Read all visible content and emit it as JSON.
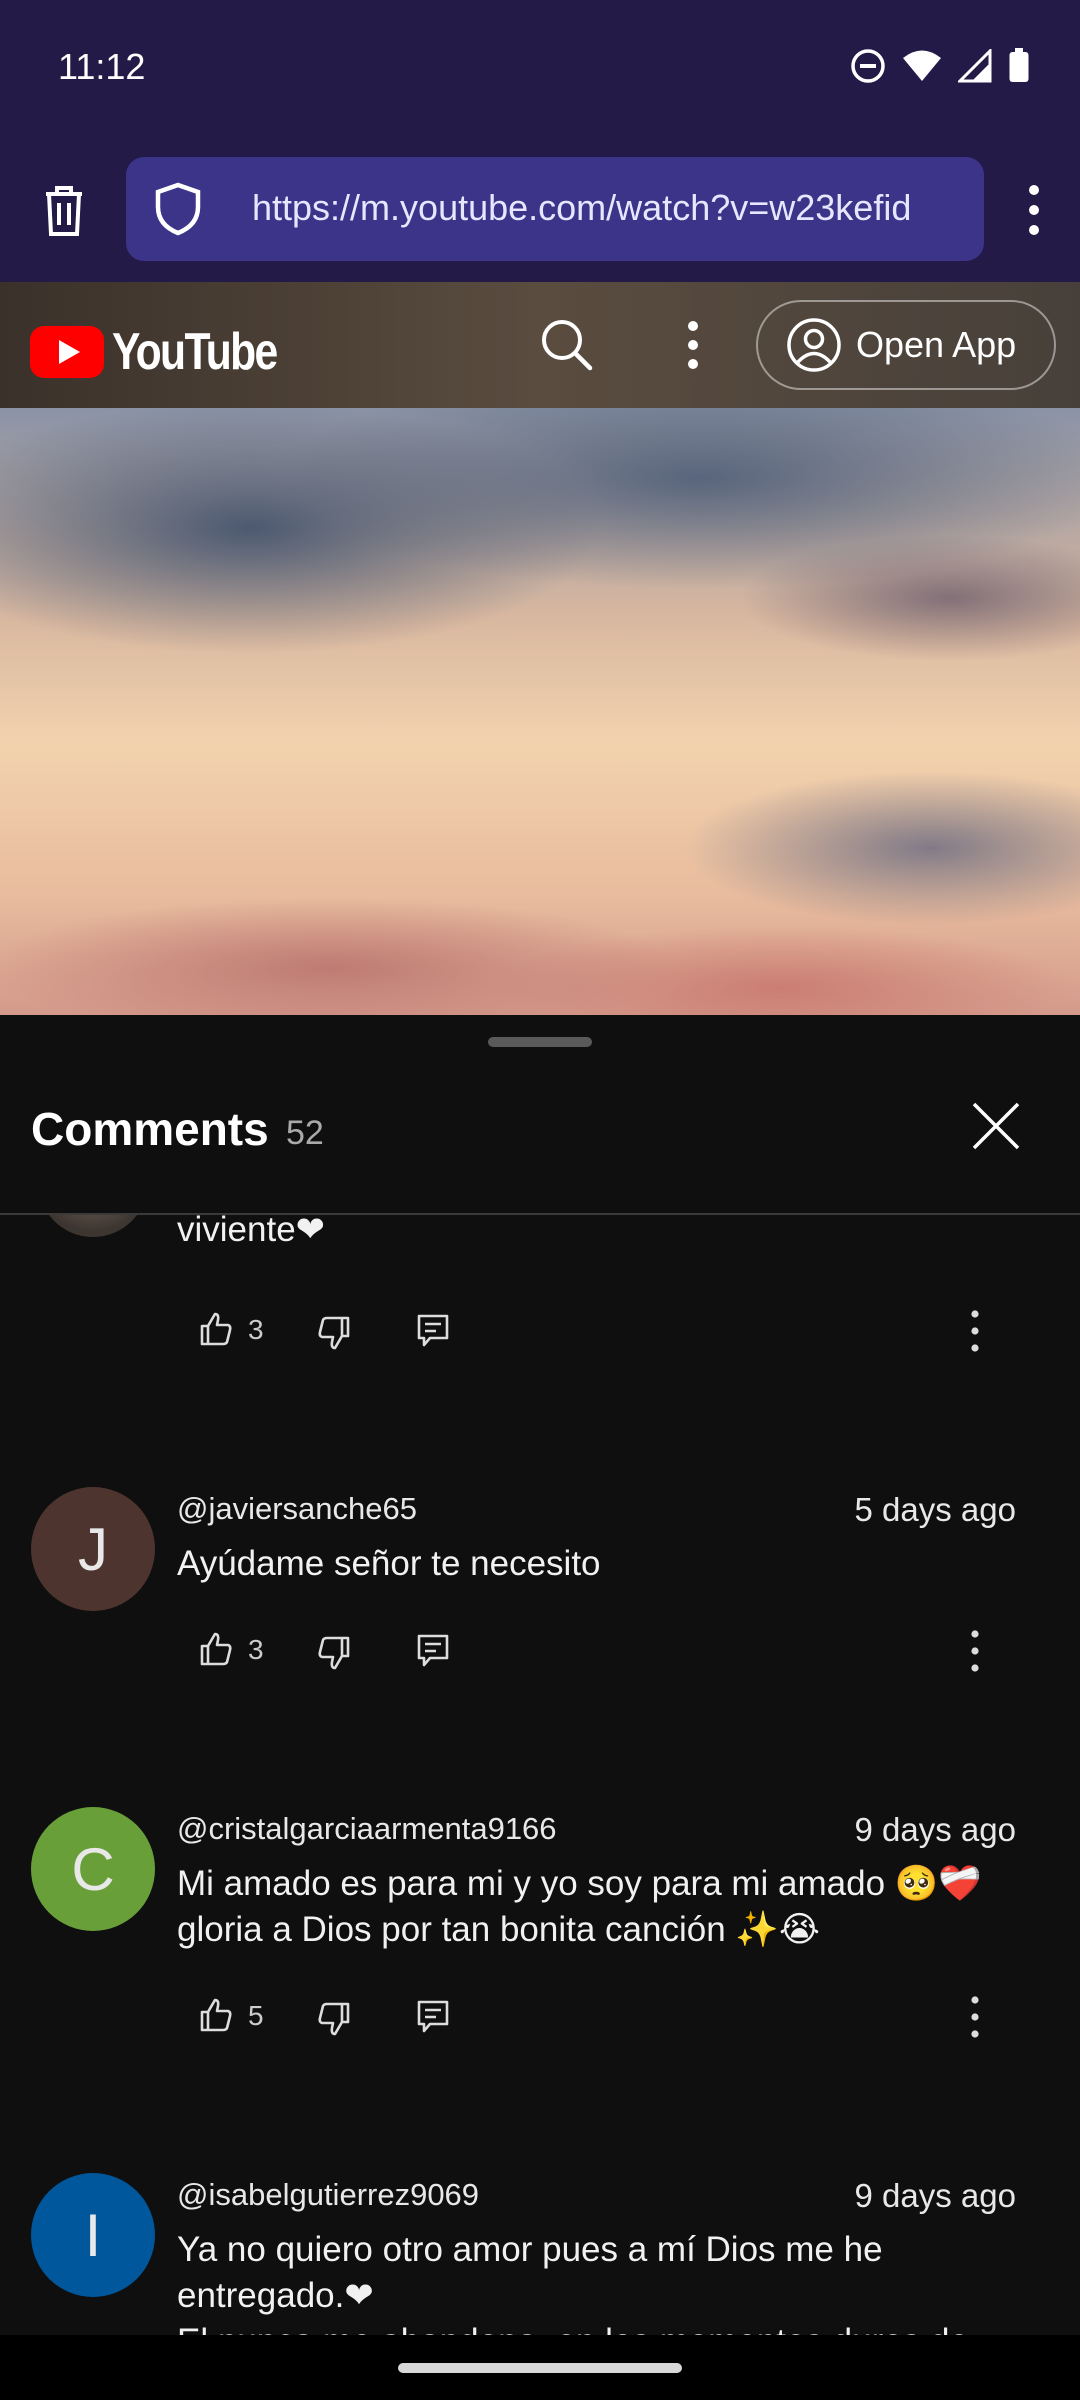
{
  "status_bar": {
    "time": "11:12"
  },
  "browser": {
    "url": "https://m.youtube.com/watch?v=w23kefid"
  },
  "youtube_header": {
    "logo_text": "YouTube",
    "open_app_label": "Open App"
  },
  "comments_panel": {
    "title": "Comments",
    "count": "52",
    "comments": [
      {
        "text": "viviente❤",
        "likes": "3"
      },
      {
        "avatar_letter": "J",
        "avatar_color": "#4e342e",
        "author": "@javiersanche65",
        "time": "5 days ago",
        "text": "Ayúdame señor te necesito",
        "likes": "3"
      },
      {
        "avatar_letter": "C",
        "avatar_color": "#689f38",
        "author": "@cristalgarciaarmenta9166",
        "time": "9 days ago",
        "text_line1": "Mi amado es para mi y yo soy para mi amado 🥺❤️‍🩹",
        "text_line2": "gloria a Dios por tan bonita canción ✨😭",
        "likes": "5"
      },
      {
        "avatar_letter": "I",
        "avatar_color": "#01579b",
        "author": "@isabelgutierrez9069",
        "time": "9 days ago",
        "text_line1": "Ya no quiero otro amor pues a mí Dios me he",
        "text_line2": "entregado.❤",
        "text_line3": "El nunca me abandona, en los momentos duros de"
      }
    ]
  },
  "colors": {
    "status_bg": "#231a47",
    "url_box": "#3b3489",
    "sheet_bg": "#0f0f0f",
    "yt_red": "#ff0000"
  }
}
